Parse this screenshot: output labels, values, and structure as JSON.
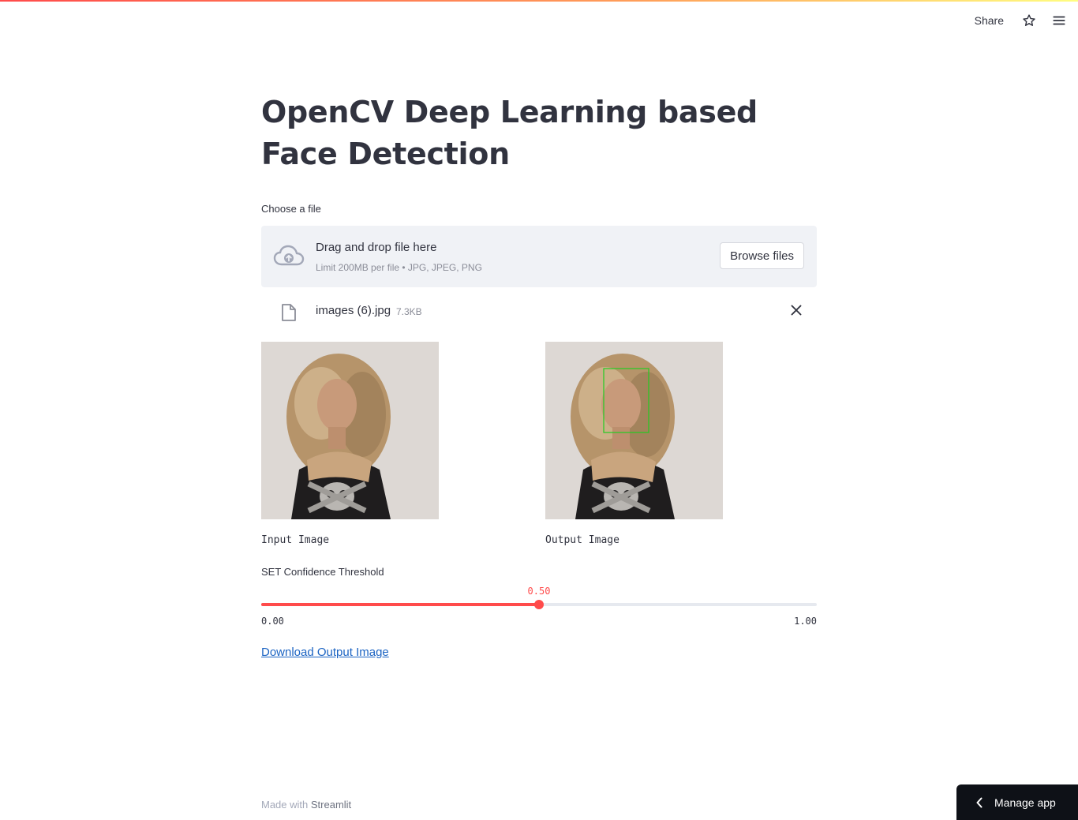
{
  "toolbar": {
    "share_label": "Share",
    "star_icon": "star-icon",
    "menu_icon": "hamburger-menu-icon"
  },
  "page": {
    "title": "OpenCV Deep Learning based Face Detection"
  },
  "uploader": {
    "label": "Choose a file",
    "dropzone_title": "Drag and drop file here",
    "dropzone_limit": "Limit 200MB per file • JPG, JPEG, PNG",
    "browse_label": "Browse files",
    "uploaded_file": {
      "name": "images (6).jpg",
      "size": "7.3KB"
    }
  },
  "images": {
    "input_caption": "Input Image",
    "output_caption": "Output Image"
  },
  "slider": {
    "label": "SET Confidence Threshold",
    "value": 0.5,
    "value_label": "0.50",
    "min_label": "0.00",
    "max_label": "1.00"
  },
  "download": {
    "label": "Download Output Image"
  },
  "footer": {
    "prefix": "Made with",
    "brand": "Streamlit"
  },
  "manage_app": {
    "label": "Manage app"
  },
  "colors": {
    "accent": "#ff4b4b",
    "link": "#1c64c3",
    "detection_box": "#22cc22",
    "text": "#31333f"
  }
}
